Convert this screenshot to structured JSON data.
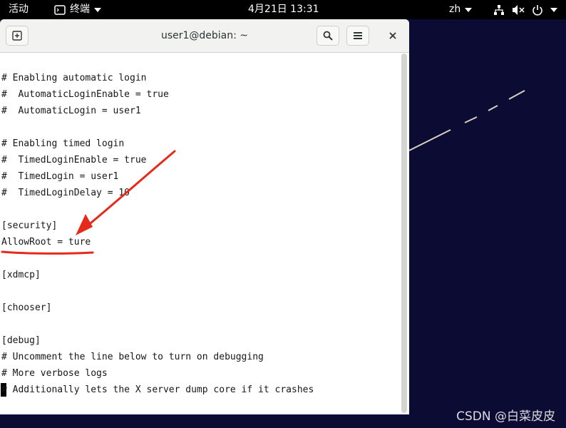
{
  "top_bar": {
    "activities": "活动",
    "app_name": "终端",
    "clock": "4月21日  13:31",
    "language": "zh"
  },
  "window": {
    "title": "user1@debian: ~"
  },
  "terminal_lines": [
    "# Enabling automatic login",
    "#  AutomaticLoginEnable = true",
    "#  AutomaticLogin = user1",
    "",
    "# Enabling timed login",
    "#  TimedLoginEnable = true",
    "#  TimedLogin = user1",
    "#  TimedLoginDelay = 10",
    "",
    "[security]",
    "AllowRoot = ture",
    "",
    "[xdmcp]",
    "",
    "[chooser]",
    "",
    "[debug]",
    "# Uncomment the line below to turn on debugging",
    "# More verbose logs",
    "# Additionally lets the X server dump core if it crashes"
  ],
  "watermark": "CSDN @白菜皮皮",
  "colors": {
    "annotation_red": "#e52a1c",
    "desktop_bg": "#0b0b33"
  }
}
